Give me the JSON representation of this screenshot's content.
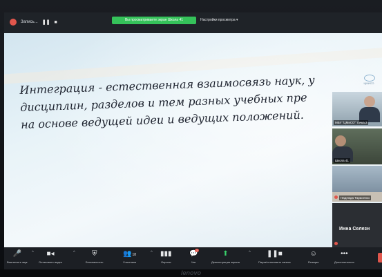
{
  "top_bar": {
    "meeting_title": "Запись...",
    "pause_icon": "pause-icon",
    "stop_icon": "stop-icon",
    "share_banner": "Вы просматриваете экран Школа 41",
    "view_options": "Настройки просмотра ▾"
  },
  "slide": {
    "lines": [
      "Интеграция - естественная взаимосвязь наук, у",
      "дисциплин, разделов и тем разных учебных пре",
      "на основе ведущей идеи и ведущих положений."
    ],
    "logo_text": "ЦМИСО"
  },
  "participants": [
    {
      "label": "МБУ \"ЦМиСО\" точка 2",
      "muted": false
    },
    {
      "label": "Школа 41",
      "muted": false
    },
    {
      "label": "Надежда Тарасенко",
      "muted": true
    },
    {
      "name": "Инна Селезн",
      "muted": true
    }
  ],
  "toolbar": {
    "items": [
      {
        "icon": "mic-icon",
        "label": "Выключить звук"
      },
      {
        "icon": "video-icon",
        "label": "Остановить видео"
      },
      {
        "icon": "shield-icon",
        "label": "Безопасность"
      },
      {
        "icon": "participants-icon",
        "label": "Участники",
        "count": "18"
      },
      {
        "icon": "chart-icon",
        "label": "Опросы"
      },
      {
        "icon": "chat-icon",
        "label": "Чат",
        "badge": "1"
      },
      {
        "icon": "share-screen-icon",
        "label": "Демонстрация экрана"
      },
      {
        "icon": "record-icon",
        "label": "Пауза/остановить запись"
      },
      {
        "icon": "reactions-icon",
        "label": "Реакции"
      },
      {
        "icon": "more-icon",
        "label": "Дополнительно"
      }
    ]
  },
  "monitor_brand": "lenovo",
  "colors": {
    "share_green": "#35c25a",
    "danger_red": "#e0564c",
    "toolbar_bg": "#1c1f24"
  }
}
